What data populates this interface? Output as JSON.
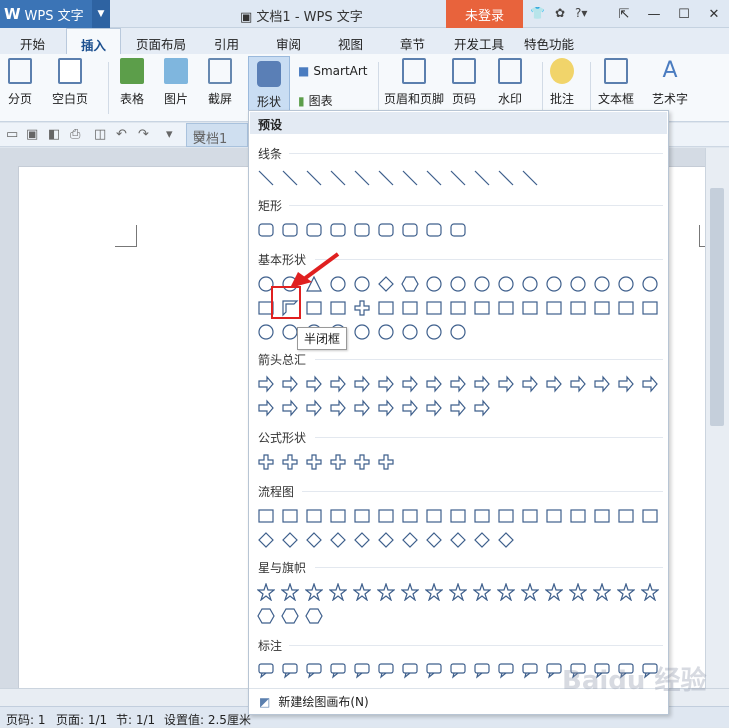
{
  "titlebar": {
    "app_name": "WPS 文字",
    "doc_title": "文档1 - WPS 文字",
    "login": "未登录"
  },
  "tabs": [
    "开始",
    "插入",
    "页面布局",
    "引用",
    "审阅",
    "视图",
    "章节",
    "开发工具",
    "特色功能"
  ],
  "ribbon": {
    "page_break": "分页",
    "blank_page": "空白页",
    "table": "表格",
    "picture": "图片",
    "screenshot": "截屏",
    "shape": "形状",
    "smartart": "SmartArt",
    "chart": "图表",
    "header_footer": "页眉和页脚",
    "page_number": "页码",
    "watermark": "水印",
    "comment": "批注",
    "textbox": "文本框",
    "wordart": "艺术字"
  },
  "quickaccess": {
    "doc_tab": "文档1"
  },
  "panel": {
    "header": "预设",
    "categories": [
      "线条",
      "矩形",
      "基本形状",
      "箭头总汇",
      "公式形状",
      "流程图",
      "星与旗帜",
      "标注"
    ],
    "tooltip": "半闭框",
    "new_canvas": "新建绘图画布(N)"
  },
  "status": {
    "page": "页码: 1",
    "pages": "页面: 1/1",
    "section": "节: 1/1",
    "setting": "设置值: 2.5厘米"
  },
  "watermark_text": "Baidu 经验",
  "colors": {
    "accent": "#3b74b6",
    "login": "#e8633c",
    "shape_stroke": "#3e5f8c",
    "highlight": "#e02020"
  }
}
